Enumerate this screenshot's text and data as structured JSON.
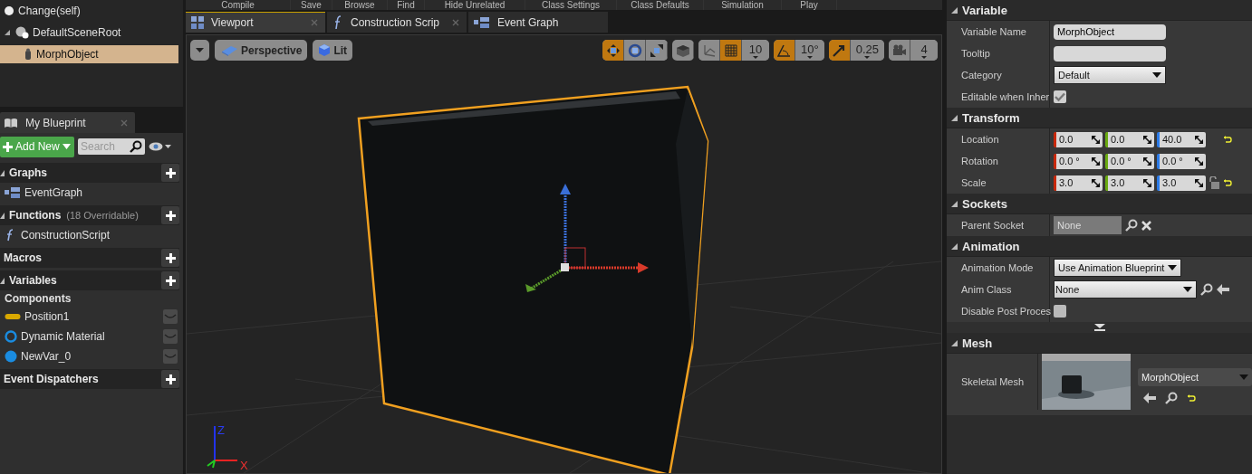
{
  "toolbar": [
    "Compile",
    "Save",
    "Browse",
    "Find",
    "Hide Unrelated",
    "Class Settings",
    "Class Defaults",
    "Simulation",
    "Play"
  ],
  "components": {
    "tree": [
      {
        "label": "Change(self)",
        "kind": "self",
        "selected": false
      },
      {
        "label": "DefaultSceneRoot",
        "kind": "scene",
        "selected": false,
        "expanded": true,
        "children": [
          {
            "label": "MorphObject",
            "kind": "mesh",
            "selected": true
          }
        ]
      }
    ]
  },
  "my_blueprint": {
    "tab": "My Blueprint",
    "add_new": "Add New",
    "search": {
      "placeholder": "Search"
    },
    "sections": [
      {
        "title": "Graphs",
        "expanded": true,
        "items": [
          {
            "label": "EventGraph",
            "kind": "graph"
          }
        ]
      },
      {
        "title": "Functions",
        "note": "(18 Overridable)",
        "expanded": true,
        "items": [
          {
            "label": "ConstructionScript",
            "kind": "function"
          }
        ]
      },
      {
        "title": "Macros",
        "expanded": false
      },
      {
        "title": "Variables",
        "expanded": true,
        "items": [
          {
            "label": "Components",
            "kind": "category"
          },
          {
            "label": "Position1",
            "kind": "struct",
            "color": "#d9a800"
          },
          {
            "label": "Dynamic Material",
            "kind": "object-ref",
            "color": "#1a8ce0"
          },
          {
            "label": "NewVar_0",
            "kind": "object",
            "color": "#1a8ce0"
          }
        ]
      },
      {
        "title": "Event Dispatchers",
        "expanded": false
      }
    ]
  },
  "editor_tabs": [
    {
      "label": "Viewport",
      "kind": "viewport",
      "selected": true,
      "closable": true
    },
    {
      "label": "Construction Scrip",
      "kind": "function",
      "selected": false,
      "closable": true
    },
    {
      "label": "Event Graph",
      "kind": "graph",
      "selected": false,
      "closable": false
    }
  ],
  "viewport": {
    "view_buttons": [
      {
        "label": "Perspective",
        "kind": "perspective"
      },
      {
        "label": "Lit",
        "kind": "lit"
      }
    ],
    "tool_groups": [
      [
        {
          "kind": "move",
          "on": true
        },
        {
          "kind": "rotate",
          "on": false
        },
        {
          "kind": "scale",
          "on": false
        }
      ],
      [
        {
          "kind": "world",
          "on": false
        }
      ],
      [
        {
          "kind": "surface",
          "on": false
        },
        {
          "kind": "grid",
          "on": true
        },
        {
          "kind": "value",
          "label": "10"
        }
      ],
      [
        {
          "kind": "angle",
          "on": true
        },
        {
          "kind": "value",
          "label": "10°"
        }
      ],
      [
        {
          "kind": "scale-snap",
          "on": true
        },
        {
          "kind": "value",
          "label": "0.25"
        }
      ],
      [
        {
          "kind": "camera",
          "on": false
        },
        {
          "kind": "value",
          "label": "4"
        }
      ]
    ],
    "axis_labels": [
      "Z",
      "X"
    ]
  },
  "details": {
    "sections": [
      {
        "title": "Variable",
        "expanded": true,
        "rows": [
          {
            "label": "Variable Name",
            "kind": "text",
            "value": "MorphObject"
          },
          {
            "label": "Tooltip",
            "kind": "text"
          },
          {
            "label": "Category",
            "kind": "dropdown",
            "value": "Default"
          },
          {
            "label": "Editable when Inher",
            "kind": "checkbox",
            "checked": true
          }
        ]
      },
      {
        "title": "Transform",
        "expanded": true,
        "rows": [
          {
            "label": "Location",
            "kind": "vector",
            "values": [
              "0.0",
              "0.0",
              "40.0"
            ],
            "reset": true,
            "lock": false
          },
          {
            "label": "Rotation",
            "kind": "vector",
            "values": [
              "0.0 °",
              "0.0 °",
              "0.0 °"
            ],
            "reset": false,
            "lock": false
          },
          {
            "label": "Scale",
            "kind": "vector",
            "values": [
              "3.0",
              "3.0",
              "3.0"
            ],
            "reset": true,
            "lock": true
          }
        ]
      },
      {
        "title": "Sockets",
        "expanded": true,
        "rows": [
          {
            "label": "Parent Socket",
            "kind": "socket",
            "value": "None"
          }
        ]
      },
      {
        "title": "Animation",
        "expanded": true,
        "more": true,
        "rows": [
          {
            "label": "Animation Mode",
            "kind": "dropdown-small",
            "value": "Use Animation Blueprint"
          },
          {
            "label": "Anim Class",
            "kind": "class",
            "value": "None"
          },
          {
            "label": "Disable Post Proces",
            "kind": "checkbox",
            "checked": false
          }
        ]
      },
      {
        "title": "Mesh",
        "expanded": true,
        "rows": [
          {
            "label": "Skeletal Mesh",
            "kind": "asset",
            "value": "MorphObject"
          }
        ]
      }
    ]
  }
}
